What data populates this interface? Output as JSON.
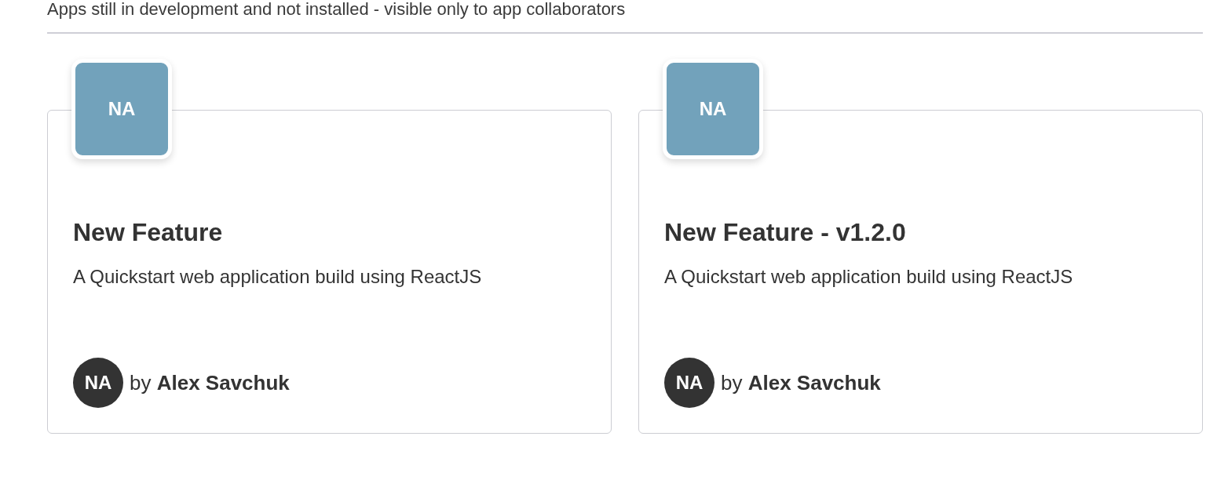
{
  "section": {
    "subtitle": "Apps still in development and not installed - visible only to app collaborators"
  },
  "apps": [
    {
      "initials": "NA",
      "title": "New Feature",
      "description": "A Quickstart web application build using ReactJS",
      "author": {
        "initials": "NA",
        "byline": "by **Alex Savchuk**"
      }
    },
    {
      "initials": "NA",
      "title": "New Feature - v1.2.0",
      "description": "A Quickstart web application build using ReactJS",
      "author": {
        "initials": "NA",
        "byline": "by **Alex Savchuk**"
      }
    }
  ]
}
